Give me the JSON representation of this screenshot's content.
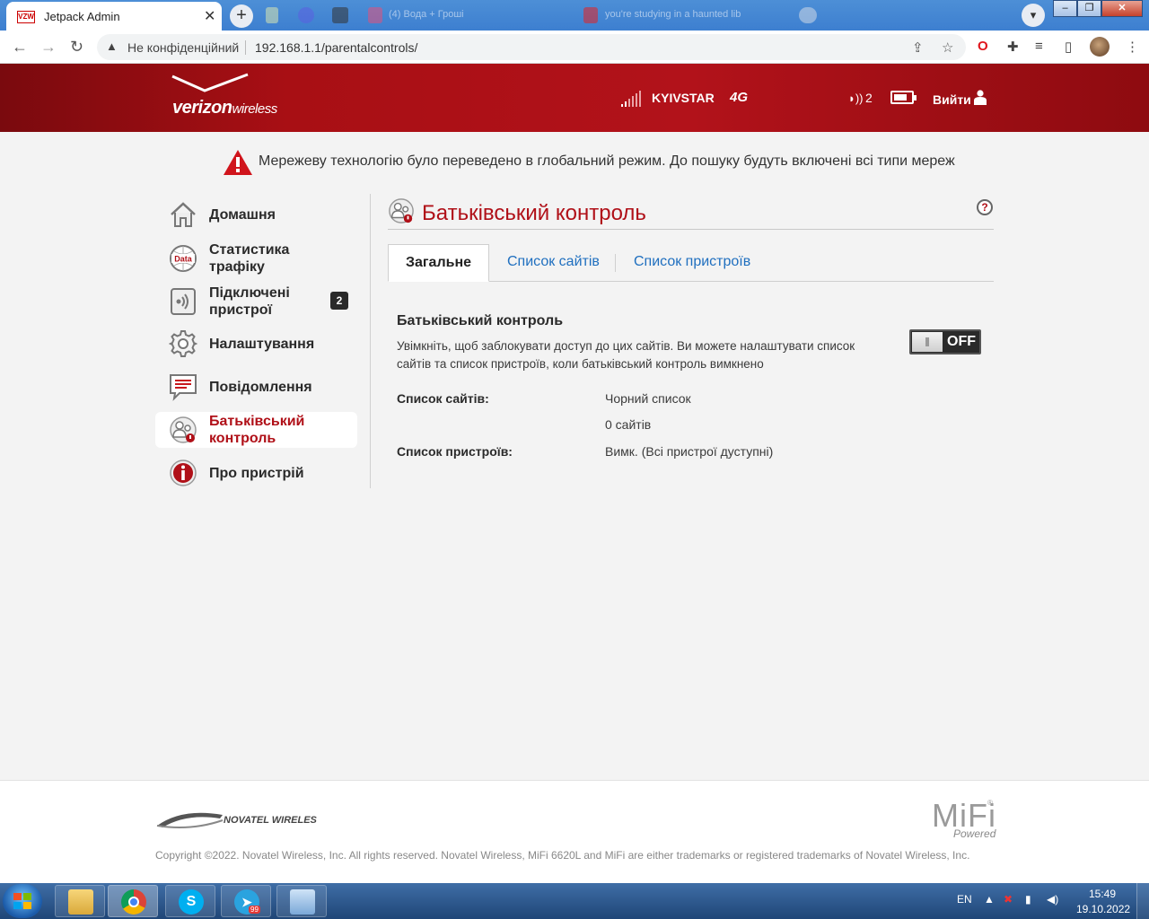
{
  "browser": {
    "tab_title": "Jetpack Admin",
    "tab_favicon_text": "VZW",
    "tab_close": "✕",
    "new_tab": "+",
    "ghost_tabs": [
      "(4) Вода + Гроші",
      "you're studying in a haunted lib"
    ],
    "address": {
      "security_label": "Не конфіденційний",
      "url": "192.168.1.1/parentalcontrols/"
    },
    "window_buttons": [
      "–",
      "❐",
      "✕"
    ]
  },
  "header": {
    "brand": "verizon",
    "brand_sub": "wireless",
    "carrier": "KYIVSTAR",
    "network": "4G",
    "connected_count": "2",
    "logout_label": "Вийти",
    "battery_level": 0.8
  },
  "alert": {
    "text": "Мережеву технологію було переведено в глобальний режим. До пошуку будуть включені всі типи мереж"
  },
  "sidebar": {
    "items": [
      {
        "label": "Домашня",
        "icon": "home-icon"
      },
      {
        "label": "Статистика трафіку",
        "icon": "data-usage-icon"
      },
      {
        "label": "Підключені пристрої",
        "icon": "connected-devices-icon",
        "badge": "2"
      },
      {
        "label": "Налаштування",
        "icon": "gear-icon"
      },
      {
        "label": "Повідомлення",
        "icon": "messages-icon"
      },
      {
        "label": "Батьківський контроль",
        "icon": "parental-controls-icon",
        "active": true
      },
      {
        "label": "Про пристрій",
        "icon": "info-icon"
      }
    ]
  },
  "main": {
    "title": "Батьківський контроль",
    "help": "?",
    "tabs": [
      {
        "label": "Загальне",
        "active": true
      },
      {
        "label": "Список сайтів"
      },
      {
        "label": "Список пристроїв"
      }
    ],
    "section": {
      "title": "Батьківський контроль",
      "description": "Увімкніть, щоб заблокувати доступ до цих сайтів. Ви можете налаштувати список сайтів та список пристроїв, коли батьківський контроль вимкнено",
      "toggle_state": "OFF"
    },
    "rows": [
      {
        "label": "Список сайтів:",
        "value": "Чорний список"
      },
      {
        "label": "",
        "value": "0 сайтів"
      },
      {
        "label": "Список пристроїв:",
        "value": "Вимк. (Всі пристрої дуступні)"
      }
    ]
  },
  "footer": {
    "vendor": "NOVATEL WIRELESS.",
    "product_logo": "MiFi",
    "product_reg": "®",
    "product_tagline": "Powered",
    "copyright": "Copyright ©2022. Novatel Wireless, Inc. All rights reserved. Novatel Wireless, MiFi 6620L and MiFi are either trademarks or registered trademarks of Novatel Wireless, Inc."
  },
  "taskbar": {
    "language": "EN",
    "time": "15:49",
    "date": "19.10.2022",
    "telegram_badge": "99"
  },
  "colors": {
    "brand_red": "#b01018",
    "link_blue": "#1f6fbf"
  }
}
